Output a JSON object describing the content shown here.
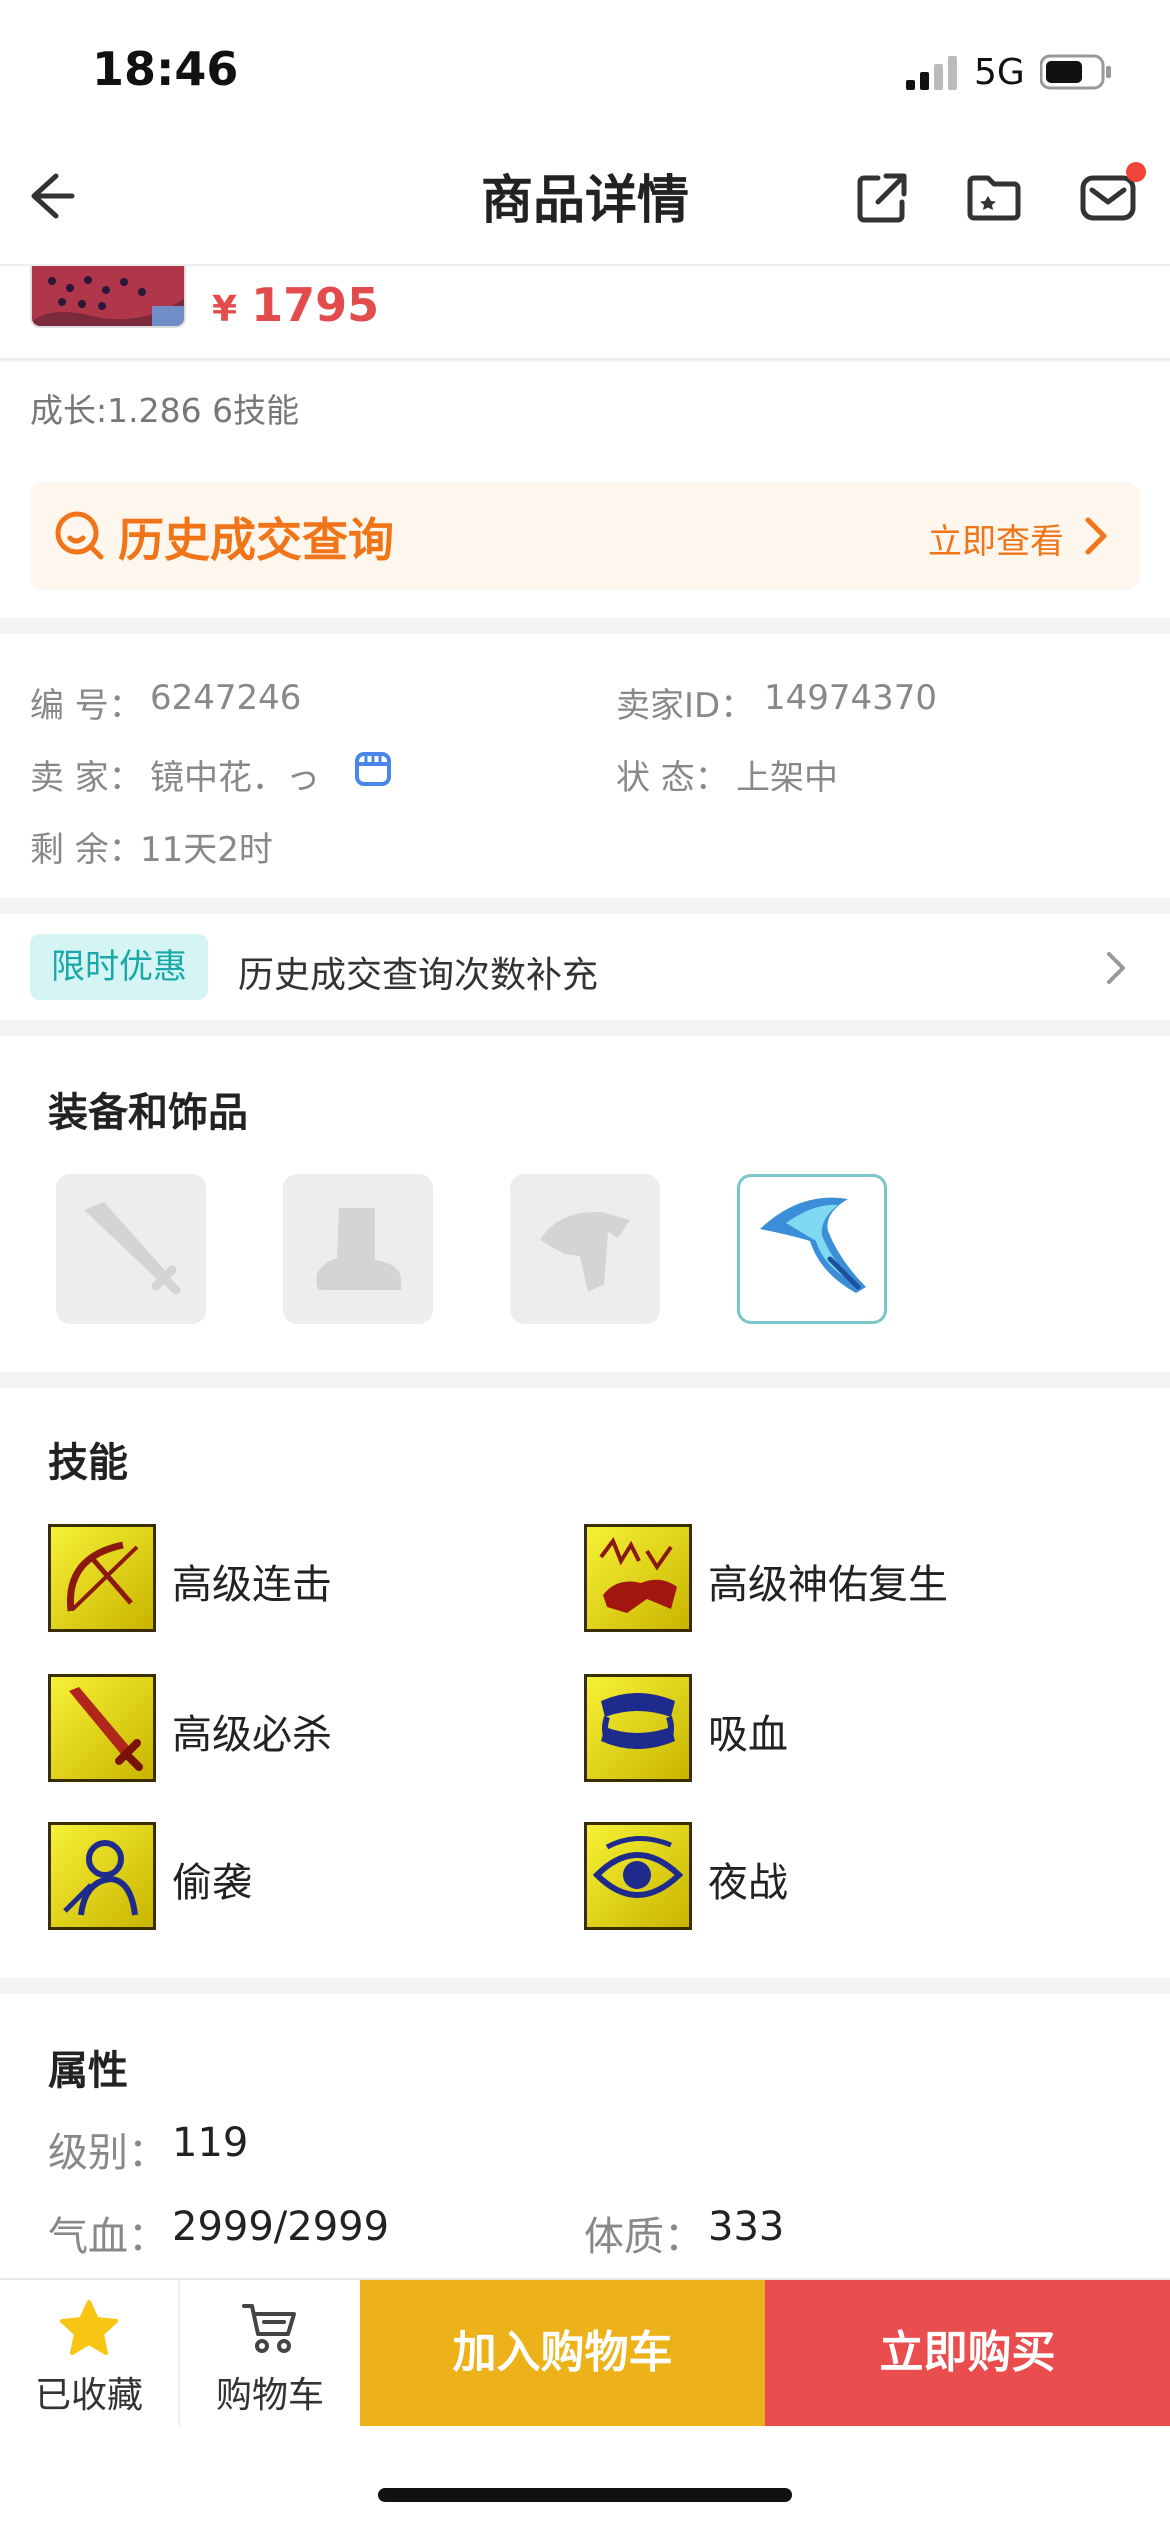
{
  "status_bar": {
    "time": "18:46",
    "network": "5G"
  },
  "nav": {
    "title": "商品详情"
  },
  "product": {
    "price_symbol": "¥",
    "price": "1795",
    "growth_skills": "成长:1.286 6技能"
  },
  "history": {
    "title": "历史成交查询",
    "link": "立即查看"
  },
  "info": {
    "id_label": "编  号：",
    "id_value": "6247246",
    "seller_id_label": "卖家ID：",
    "seller_id_value": "14974370",
    "seller_label": "卖  家：",
    "seller_value": "镜中花．っ",
    "status_label": "状  态：",
    "status_value": "上架中",
    "remain_label": "剩  余：",
    "remain_value": "11天2时"
  },
  "promo": {
    "badge": "限时优惠",
    "text": "历史成交查询次数补充"
  },
  "equipment": {
    "title": "装备和饰品"
  },
  "skills": {
    "title": "技能",
    "items": [
      {
        "name": "高级连击",
        "icon": "bow-skill-icon"
      },
      {
        "name": "高级神佑复生",
        "icon": "revive-skill-icon"
      },
      {
        "name": "高级必杀",
        "icon": "sword-skill-icon"
      },
      {
        "name": "吸血",
        "icon": "fang-skill-icon"
      },
      {
        "name": "偷袭",
        "icon": "sneak-skill-icon"
      },
      {
        "name": "夜战",
        "icon": "eye-skill-icon"
      }
    ]
  },
  "attributes": {
    "title": "属性",
    "level_label": "级别：",
    "level_value": "119",
    "hp_label": "气血：",
    "hp_value": "2999/2999",
    "con_label": "体质：",
    "con_value": "333"
  },
  "bottom": {
    "favorite_label": "已收藏",
    "cart_label": "购物车",
    "add_cart": "加入购物车",
    "buy_now": "立即购买"
  },
  "colors": {
    "price": "#e24c4c",
    "history": "#f07418",
    "promo": "#18a8a8",
    "add_cart_bg": "#edb11a",
    "buy_bg": "#e94d4d",
    "favorite_star": "#f9c514"
  }
}
